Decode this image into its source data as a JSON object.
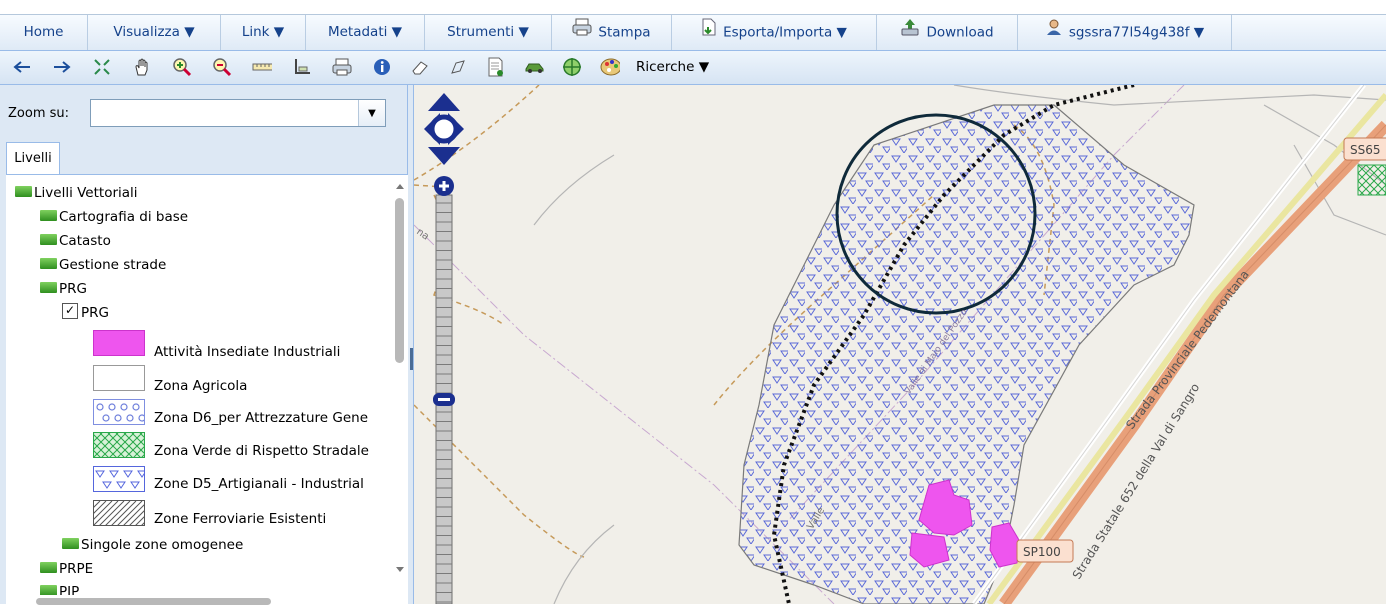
{
  "menu": {
    "home": "Home",
    "visualizza": "Visualizza ▼",
    "link": "Link ▼",
    "metadati": "Metadati ▼",
    "strumenti": "Strumenti ▼",
    "stampa": "Stampa",
    "esporta": "Esporta/Importa ▼",
    "download": "Download",
    "user": "sgssra77l54g438f ▼"
  },
  "toolbar": {
    "ricerche": "Ricerche ▼",
    "icons": [
      "back-arrow-icon",
      "forward-arrow-icon",
      "zoom-extent-icon",
      "pan-hand-icon",
      "zoom-in-icon",
      "zoom-out-icon",
      "ruler-icon",
      "area-measure-icon",
      "print-icon",
      "info-icon",
      "eraser-icon",
      "draw-icon",
      "document-icon",
      "car-icon",
      "target-icon",
      "palette-icon"
    ]
  },
  "sidebar": {
    "zoom_label": "Zoom su:",
    "zoom_value": "",
    "tab": "Livelli",
    "tree": {
      "root": "Livelli Vettoriali",
      "items": [
        "Cartografia di base",
        "Catasto",
        "Gestione strade",
        "PRG"
      ],
      "prg_layer": "PRG",
      "legend": [
        {
          "label": "Attività Insediate Industriali",
          "color": "#ee55ee"
        },
        {
          "label": "Zona Agricola",
          "color": "#ffffff"
        },
        {
          "label": "Zona D6_per Attrezzature Gene",
          "color": "#7f8fe0"
        },
        {
          "label": "Zona Verde di Rispetto Stradale",
          "color": "#2aa84a"
        },
        {
          "label": "Zone D5_Artigianali - Industrial",
          "color": "#5566dd"
        },
        {
          "label": "Zone Ferroviarie Esistenti",
          "color": "#555555"
        }
      ],
      "after": [
        "Singole zone omogenee",
        "PRPE",
        "PIP"
      ]
    }
  },
  "map": {
    "labels": {
      "ss": "SS65",
      "sp100": "SP100",
      "strada_pedemontana": "Strada Provinciale Pedemontana",
      "strada_statale": "Strada Statale 652 della Val di Sangro",
      "valle": "Valle",
      "na": "na",
      "contrada": "Valle di Maio del Pozzo"
    }
  }
}
